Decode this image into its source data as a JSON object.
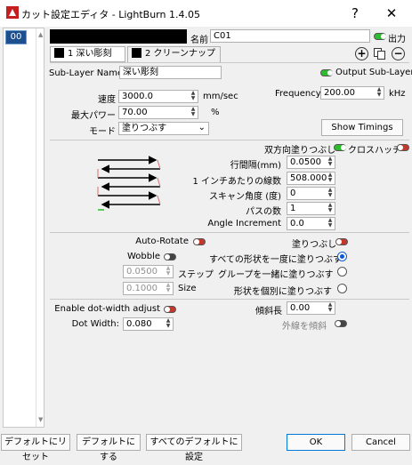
{
  "window": {
    "title": "カット設定エディタ - LightBurn 1.4.05",
    "help_label": "?",
    "close_label": "✕"
  },
  "layer_list": {
    "items": [
      "00"
    ]
  },
  "layer": {
    "name_label": "名前",
    "name_value": "C01",
    "output_label": "出力",
    "color": "#000000"
  },
  "tabs": [
    {
      "label": "1 深い彫刻"
    },
    {
      "label": "2 クリーンナップ"
    }
  ],
  "sublayer": {
    "name_label": "Sub-Layer Name",
    "name_value": "深い彫刻",
    "output_label": "Output Sub-Layer"
  },
  "params": {
    "speed_label": "速度",
    "speed_value": "3000.0",
    "speed_unit": "mm/sec",
    "frequency_label": "Frequency",
    "frequency_value": "200.00",
    "frequency_unit": "kHz",
    "power_label": "最大パワー",
    "power_value": "70.00",
    "power_unit": "%",
    "mode_label": "モード",
    "mode_value": "塗りつぶす",
    "show_timings_label": "Show Timings"
  },
  "fill": {
    "bidirectional_label": "双方向塗りつぶし",
    "crosshatch_label": "クロスハッチ",
    "interval_label": "行間隔(mm)",
    "interval_value": "0.0500",
    "lpi_label": "1 インチあたりの線数",
    "lpi_value": "508.000",
    "scan_angle_label": "スキャン角度 (度)",
    "scan_angle_value": "0",
    "passes_label": "パスの数",
    "passes_value": "1",
    "angle_increment_label": "Angle Increment",
    "angle_increment_value": "0.0"
  },
  "options": {
    "auto_rotate_label": "Auto-Rotate",
    "fill_label": "塗りつぶし",
    "wobble_label": "Wobble",
    "step_value": "0.0500",
    "step_label": "ステップ",
    "size_value": "0.1000",
    "size_label": "Size",
    "fill_all_label": "すべての形状を一度に塗りつぶす",
    "fill_groups_label": "グループを一緒に塗りつぶす",
    "fill_individual_label": "形状を個別に塗りつぶす"
  },
  "dot": {
    "enable_label": "Enable dot-width adjust",
    "width_label": "Dot Width:",
    "width_value": "0.080",
    "ramp_length_label": "傾斜長",
    "ramp_length_value": "0.00",
    "ramp_outer_label": "外線を傾斜"
  },
  "footer": {
    "reset_default_label": "デフォルトにリセット",
    "make_default_label": "デフォルトにする",
    "set_all_default_label": "すべてのデフォルトに設定",
    "ok_label": "OK",
    "cancel_label": "Cancel"
  },
  "colors": {
    "toggle_on": "#2bbd2b",
    "toggle_off": "#c0392b",
    "layer_selected": "#1d4f8e",
    "accent": "#0078d7"
  }
}
